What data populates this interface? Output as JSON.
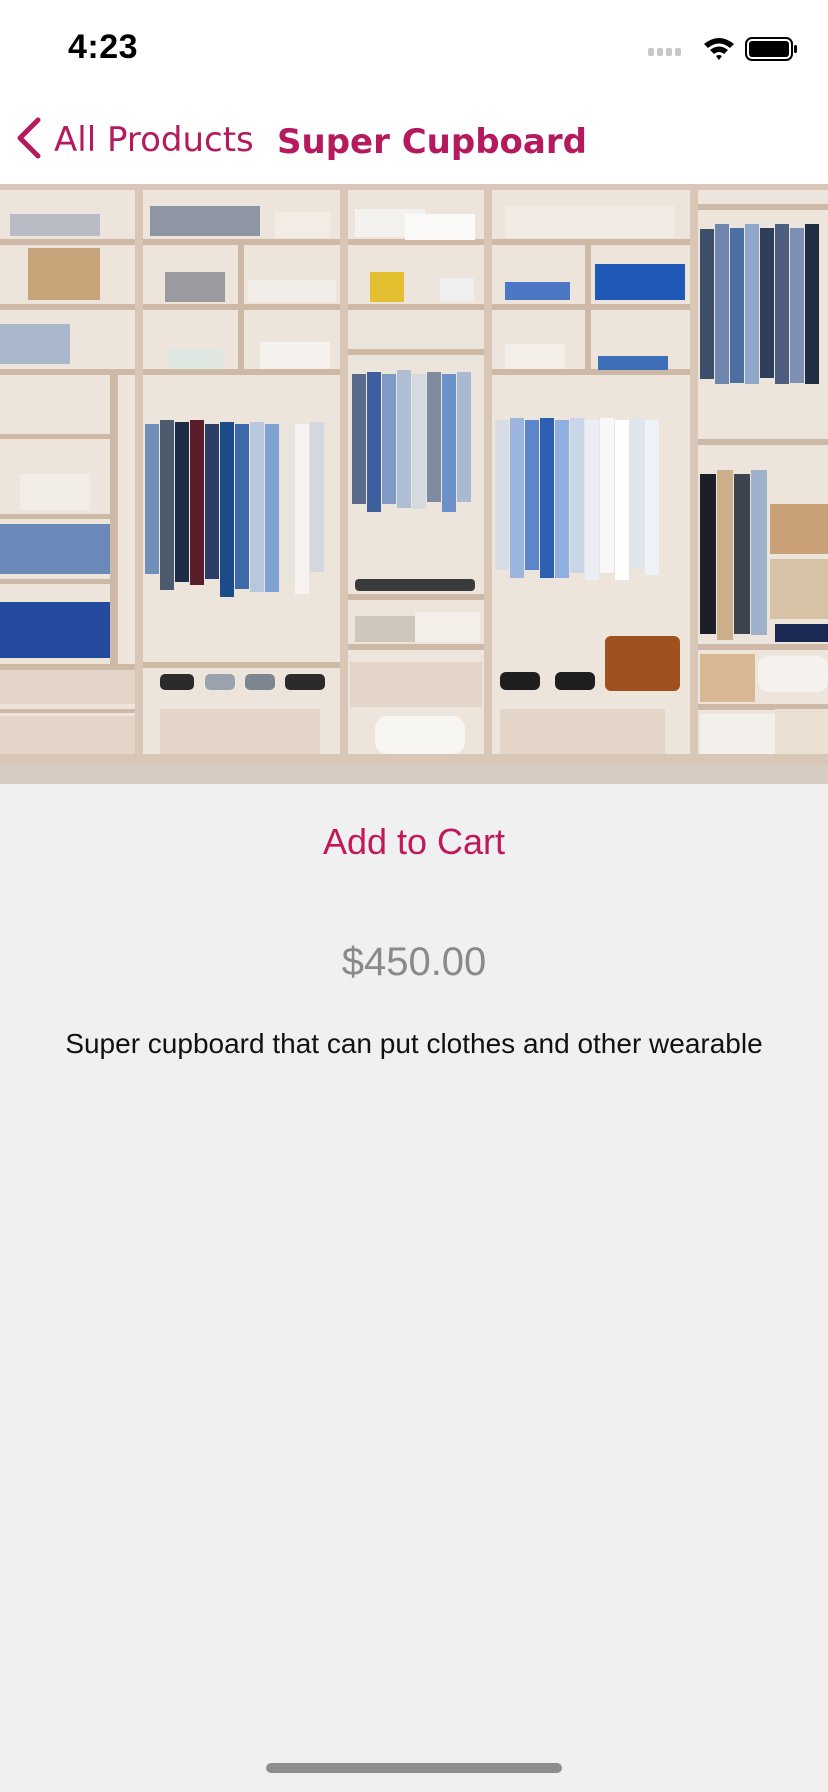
{
  "status": {
    "time": "4:23",
    "signal_icon": "signal-icon",
    "wifi_icon": "wifi-icon",
    "battery_icon": "battery-icon"
  },
  "nav": {
    "back_label": "All Products",
    "back_icon": "chevron-left-icon",
    "title": "Super Cupboard"
  },
  "product": {
    "image_desc_icon": "wardrobe-photo",
    "add_to_cart_label": "Add to Cart",
    "price": "$450.00",
    "description": "Super cupboard that can put clothes and other wearable"
  },
  "colors": {
    "accent": "#c2185b",
    "nav_tint": "#b5195e",
    "background": "#f0f0f0",
    "price_gray": "#8a8a8a"
  }
}
